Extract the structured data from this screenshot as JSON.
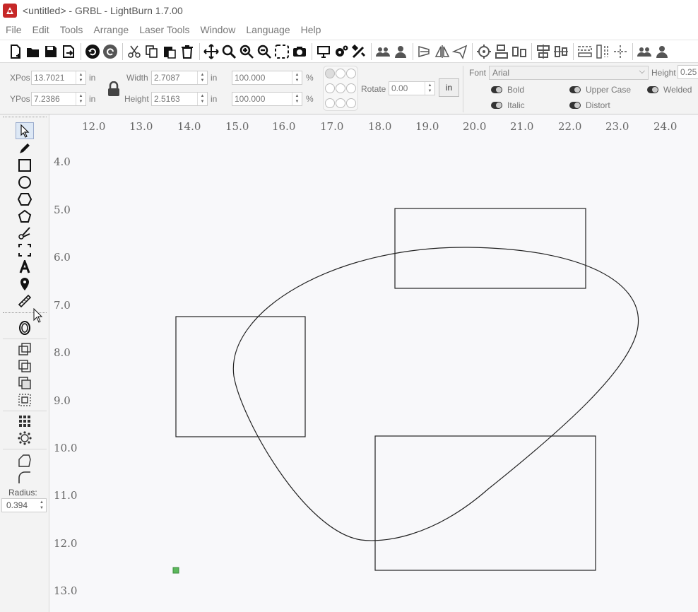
{
  "window": {
    "title": "<untitled> - GRBL - LightBurn 1.7.00",
    "app_icon": "lightburn-logo-icon"
  },
  "menu": [
    "File",
    "Edit",
    "Tools",
    "Arrange",
    "Laser Tools",
    "Window",
    "Language",
    "Help"
  ],
  "properties": {
    "xpos_label": "XPos",
    "xpos_value": "13.7021",
    "ypos_label": "YPos",
    "ypos_value": "7.2386",
    "unit": "in",
    "width_label": "Width",
    "width_value": "2.7087",
    "height_label": "Height",
    "height_value": "2.5163",
    "scale_x": "100.000",
    "scale_y": "100.000",
    "percent": "%",
    "rotate_label": "Rotate",
    "rotate_value": "0.00",
    "unit_button": "in",
    "font_label": "Font",
    "font_value": "Arial",
    "text_height_label": "Height",
    "text_height_value": "0.25",
    "bold_label": "Bold",
    "italic_label": "Italic",
    "upper_case_label": "Upper Case",
    "distort_label": "Distort",
    "welded_label": "Welded"
  },
  "tool_panel": {
    "radius_label": "Radius:",
    "radius_value": "0.394"
  },
  "rulers": {
    "x": [
      "12.0",
      "13.0",
      "14.0",
      "15.0",
      "16.0",
      "17.0",
      "18.0",
      "19.0",
      "20.0",
      "21.0",
      "22.0",
      "23.0",
      "24.0"
    ],
    "y": [
      "4.0",
      "5.0",
      "6.0",
      "7.0",
      "8.0",
      "9.0",
      "10.0",
      "11.0",
      "12.0",
      "13.0"
    ]
  },
  "colors": {
    "accent": "#c62828",
    "origin_marker": "#5cb85c",
    "shape_stroke": "#222222",
    "canvas_bg": "#f8f8fa"
  }
}
